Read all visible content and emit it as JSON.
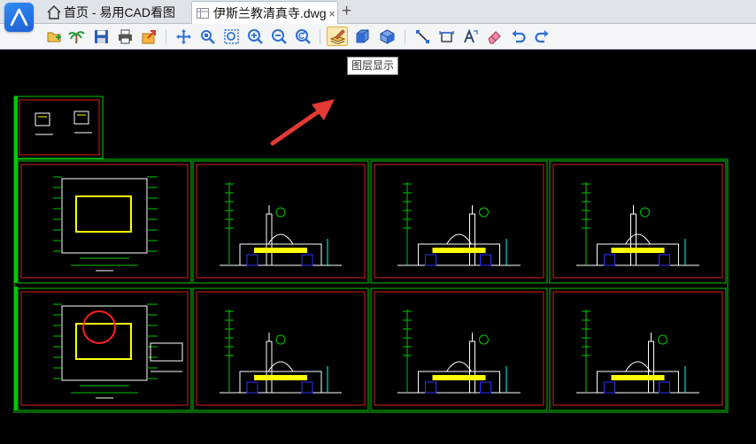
{
  "tabs": {
    "home_label": "首页 - 易用CAD看图",
    "file_label": "伊斯兰教清真寺.dwg",
    "close_glyph": "×",
    "add_glyph": "+"
  },
  "toolbar": {
    "buttons": [
      {
        "name": "open-file-icon"
      },
      {
        "name": "palm-tree-icon"
      },
      {
        "name": "save-icon"
      },
      {
        "name": "print-icon"
      },
      {
        "name": "export-icon"
      },
      {
        "name": "pan-icon"
      },
      {
        "name": "zoom-window-icon"
      },
      {
        "name": "zoom-extents-icon"
      },
      {
        "name": "zoom-in-icon"
      },
      {
        "name": "zoom-out-icon"
      },
      {
        "name": "zoom-previous-icon"
      },
      {
        "name": "layer-display-icon"
      },
      {
        "name": "3d-box-icon"
      },
      {
        "name": "3d-view-icon"
      },
      {
        "name": "measure-line-icon"
      },
      {
        "name": "measure-area-icon"
      },
      {
        "name": "text-edit-icon"
      },
      {
        "name": "eraser-icon"
      },
      {
        "name": "undo-icon"
      },
      {
        "name": "redo-icon"
      }
    ],
    "tooltip_text": "图层显示"
  },
  "colors": {
    "frame_green": "#00c800",
    "frame_red": "#d42020",
    "drawing_white": "#ffffff",
    "drawing_yellow": "#ffff00",
    "drawing_blue": "#3030ff",
    "drawing_cyan": "#00ffff",
    "arrow_red": "#e53935",
    "active_button": "#fde7b0"
  }
}
